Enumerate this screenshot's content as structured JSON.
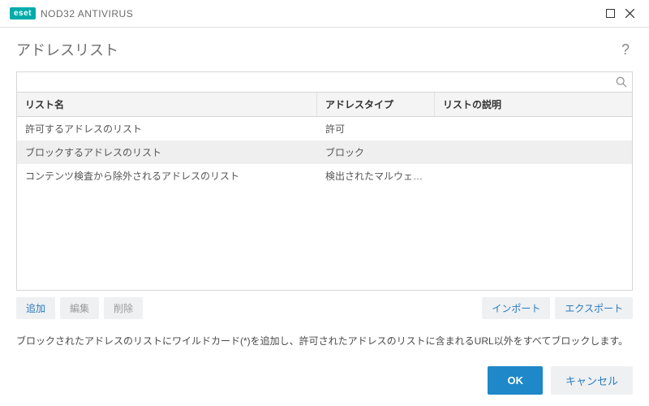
{
  "brand": {
    "logo": "eset",
    "product": "NOD32 ANTIVIRUS"
  },
  "page_title": "アドレスリスト",
  "search": {
    "value": ""
  },
  "table": {
    "headers": {
      "name": "リスト名",
      "type": "アドレスタイプ",
      "desc": "リストの説明"
    },
    "rows": [
      {
        "name": "許可するアドレスのリスト",
        "type": "許可",
        "desc": "",
        "selected": false
      },
      {
        "name": "ブロックするアドレスのリスト",
        "type": "ブロック",
        "desc": "",
        "selected": true
      },
      {
        "name": "コンテンツ検査から除外されるアドレスのリスト",
        "type": "検出されたマルウェアは無視...",
        "desc": "",
        "selected": false
      }
    ]
  },
  "actions": {
    "add": "追加",
    "edit": "編集",
    "delete": "削除",
    "import": "インポート",
    "export": "エクスポート"
  },
  "hint": "ブロックされたアドレスのリストにワイルドカード(*)を追加し、許可されたアドレスのリストに含まれるURL以外をすべてブロックします。",
  "footer": {
    "ok": "OK",
    "cancel": "キャンセル"
  }
}
